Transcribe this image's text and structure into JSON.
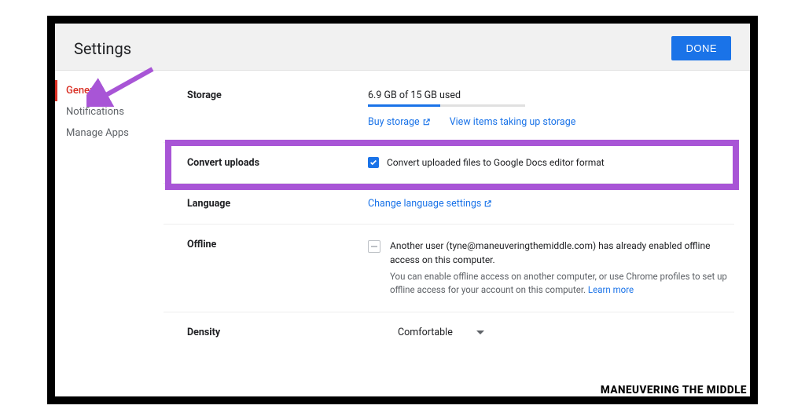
{
  "header": {
    "title": "Settings",
    "done_label": "DONE"
  },
  "sidebar": {
    "items": [
      {
        "label": "General",
        "active": true
      },
      {
        "label": "Notifications",
        "active": false
      },
      {
        "label": "Manage Apps",
        "active": false
      }
    ]
  },
  "sections": {
    "storage": {
      "label": "Storage",
      "usage_text": "6.9 GB of 15 GB used",
      "used_percent": 46,
      "buy_label": "Buy storage",
      "view_label": "View items taking up storage"
    },
    "convert": {
      "label": "Convert uploads",
      "checkbox_checked": true,
      "checkbox_label": "Convert uploaded files to Google Docs editor format"
    },
    "language": {
      "label": "Language",
      "link_label": "Change language settings"
    },
    "offline": {
      "label": "Offline",
      "main_text": "Another user (tyne@maneuveringthemiddle.com) has already enabled offline access on this computer.",
      "sub_text": "You can enable offline access on another computer, or use Chrome profiles to set up offline access for your account on this computer. ",
      "learn_more": "Learn more"
    },
    "density": {
      "label": "Density",
      "value": "Comfortable"
    }
  },
  "watermark": "MANEUVERING THE MIDDLE"
}
